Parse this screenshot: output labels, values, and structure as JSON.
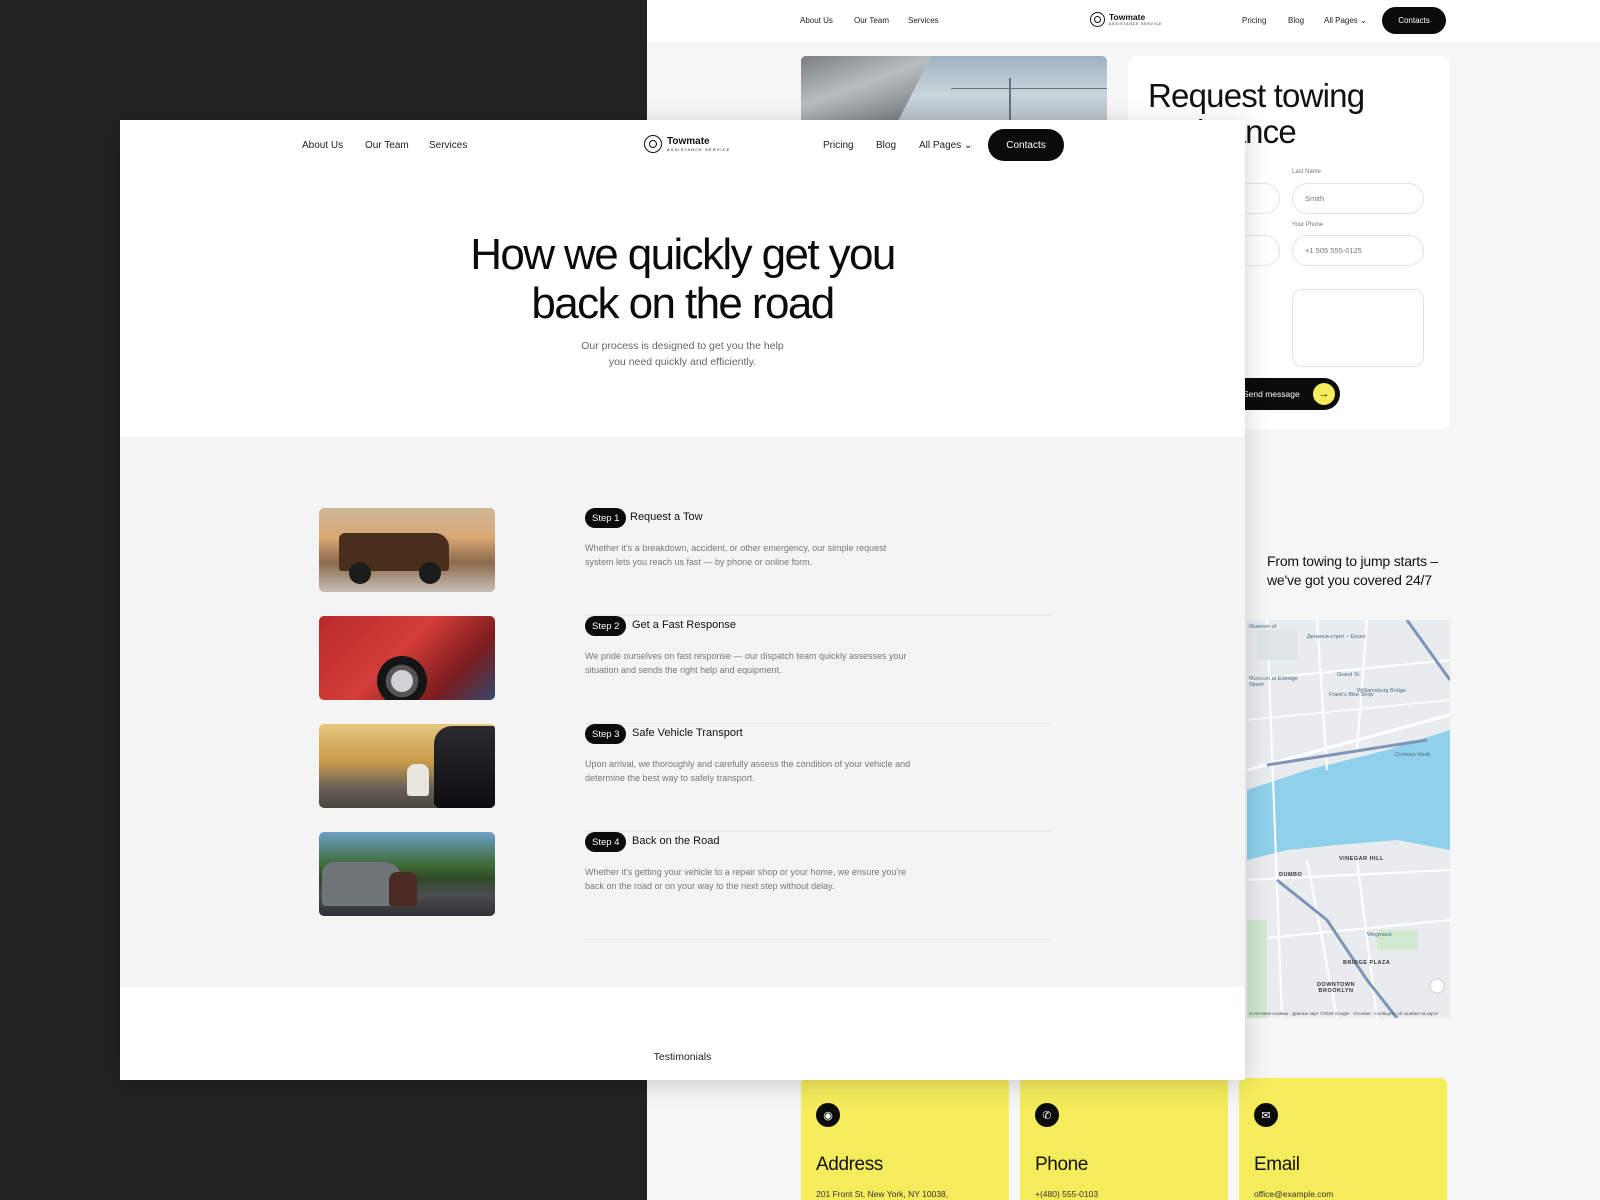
{
  "back_page": {
    "nav": {
      "left": [
        "About Us",
        "Our Team",
        "Services"
      ],
      "right": [
        "Pricing",
        "Blog",
        "All Pages"
      ],
      "brand": "Towmate",
      "brand_tag": "ASSISTANCE SERVICE",
      "contacts": "Contacts"
    },
    "form": {
      "title": "Request towing assistance",
      "last_name_label": "Last Name",
      "last_name_placeholder": "Smith",
      "phone_label": "Your Phone",
      "phone_placeholder": "+1 505 555-0125",
      "send": "Send message"
    },
    "tagline": [
      "From towing to jump starts –",
      "we've got you covered 24/7"
    ],
    "map": {
      "labels": [
        "Museum of",
        "Деланси-стрит – Essex",
        "Grand St",
        "Williamsburg Bridge",
        "Museum at Eldridge Street",
        "Frank's Bike Shop",
        "Corlears Hook",
        "DUMBO",
        "VINEGAR HILL",
        "BRIDGE PLAZA",
        "DOWNTOWN BROOKLYN",
        "Wegmans"
      ],
      "credit": "Сочетания клавиш · Данные карт ©2025 Google · Условия · Сообщить об ошибке на карте"
    },
    "cards": [
      {
        "title": "Address",
        "value": "201 Front St, New York, NY 10038,",
        "icon": "pin-icon"
      },
      {
        "title": "Phone",
        "value": "+(480) 555-0103",
        "icon": "phone-icon"
      },
      {
        "title": "Email",
        "value": "office@example.com",
        "icon": "mail-icon"
      }
    ],
    "accent": "#f5ec5b"
  },
  "front_page": {
    "nav": {
      "left": [
        "About Us",
        "Our Team",
        "Services"
      ],
      "right": [
        "Pricing",
        "Blog",
        "All Pages"
      ],
      "brand": "Towmate",
      "brand_tag": "ASSISTANCE SERVICE",
      "contacts": "Contacts"
    },
    "title_line1": "How we quickly get you",
    "title_line2": "back on the road",
    "subtitle_line1": "Our process is designed to get you the help",
    "subtitle_line2": "you need quickly and efficiently.",
    "steps": [
      {
        "pill": "Step 1",
        "name": "Request a Tow",
        "desc": "Whether it's a breakdown, accident, or other emergency, our simple request system lets you reach us fast — by phone or online form."
      },
      {
        "pill": "Step 2",
        "name": "Get a Fast Response",
        "desc": "We pride ourselves on fast response — our dispatch team quickly assesses your situation and sends the right help and equipment."
      },
      {
        "pill": "Step 3",
        "name": "Safe Vehicle Transport",
        "desc": "Upon arrival, we thoroughly and carefully assess the condition of your vehicle and determine the best way to safely transport."
      },
      {
        "pill": "Step 4",
        "name": "Back on the Road",
        "desc": "Whether it's getting your vehicle to a repair shop or your home, we ensure you're back on the road or on your way to the next step without delay."
      }
    ],
    "testimonials": "Testimonials"
  }
}
